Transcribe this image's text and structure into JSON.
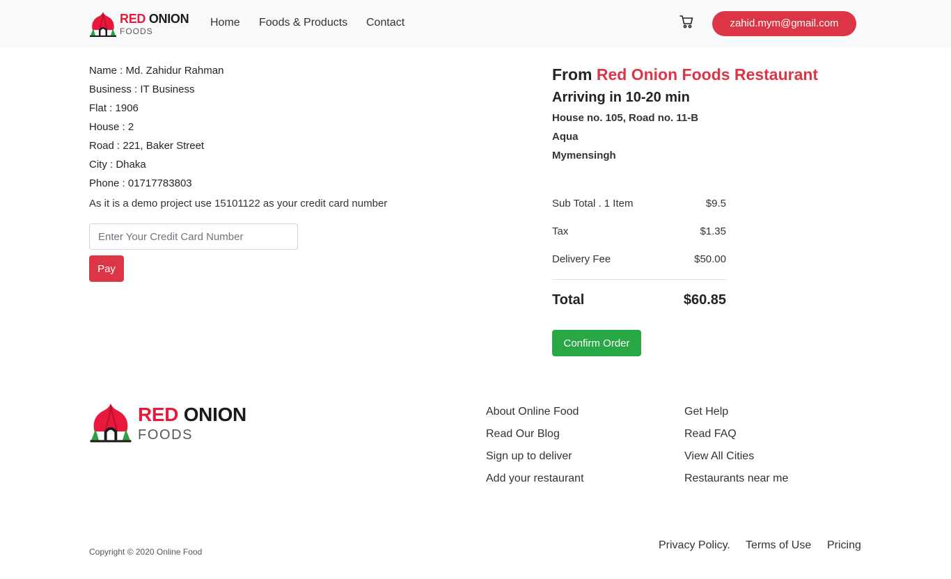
{
  "header": {
    "logo": {
      "top": "RED ONION",
      "top_red": "RED",
      "top_dark": "ONION",
      "bottom": "FOODS"
    },
    "nav": [
      {
        "label": "Home"
      },
      {
        "label": "Foods & Products"
      },
      {
        "label": "Contact"
      }
    ],
    "cart_icon": "cart-icon",
    "user_email": "zahid.mym@gmail.com"
  },
  "shipping": {
    "lines": [
      "Name : Md. Zahidur Rahman",
      "Business : IT Business",
      "Flat : 1906",
      "House : 2",
      "Road : 221, Baker Street",
      "City : Dhaka",
      "Phone : 01717783803"
    ],
    "demo_note": "As it is a demo project use 15101122 as your credit card number",
    "card_input_placeholder": "Enter Your Credit Card Number",
    "card_input_value": "",
    "pay_label": "Pay"
  },
  "order": {
    "from_prefix": "From",
    "restaurant": "Red Onion Foods Restaurant",
    "arriving": "Arriving in 10-20 min",
    "address": [
      "House no. 105, Road no. 11-B",
      "Aqua",
      "Mymensingh"
    ],
    "summary": [
      {
        "label": "Sub Total . 1 Item",
        "value": "$9.5"
      },
      {
        "label": "Tax",
        "value": "$1.35"
      },
      {
        "label": "Delivery Fee",
        "value": "$50.00"
      }
    ],
    "total_label": "Total",
    "total_value": "$60.85",
    "confirm_label": "Confirm Order"
  },
  "footer": {
    "logo": {
      "top_red": "RED",
      "top_dark": "ONION",
      "bottom": "FOODS"
    },
    "links_col1": [
      "About Online Food",
      "Read Our Blog",
      "Sign up to deliver",
      "Add your restaurant"
    ],
    "links_col2": [
      "Get Help",
      "Read FAQ",
      "View All Cities",
      "Restaurants near me"
    ],
    "copyright": "Copyright © 2020 Online Food",
    "legal": [
      "Privacy Policy.",
      "Terms of Use",
      "Pricing"
    ]
  },
  "colors": {
    "brand_red": "#e8193c",
    "button_red": "#dc3545",
    "confirm_green": "#28a745",
    "navbar_bg": "#f8f9fa"
  }
}
